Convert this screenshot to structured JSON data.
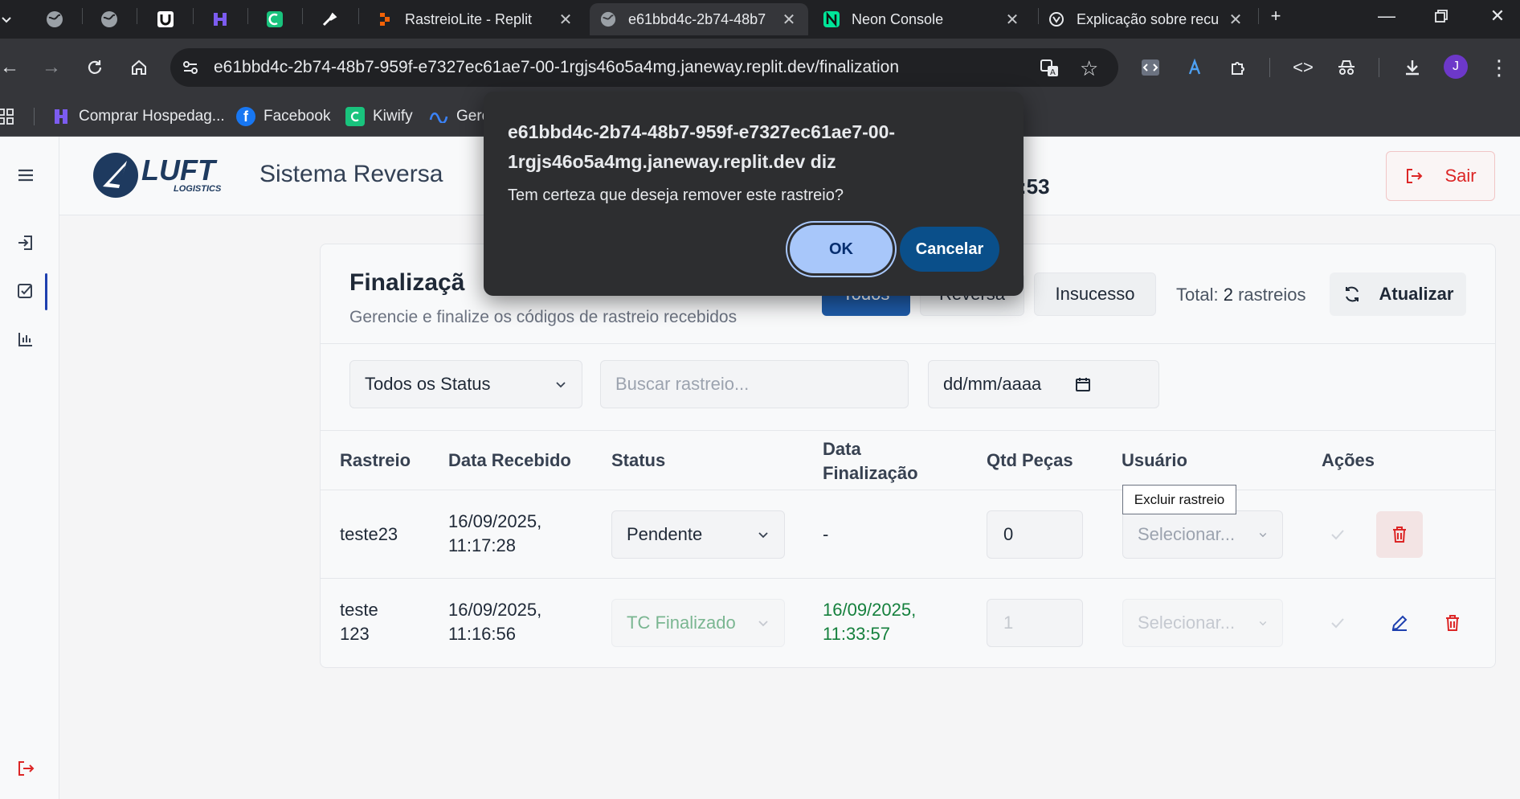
{
  "browser": {
    "tabs": [
      {
        "title": "RastreioLite - Replit"
      },
      {
        "title": "e61bbd4c-2b74-48b7"
      },
      {
        "title": "Neon Console"
      },
      {
        "title": "Explicação sobre recu"
      }
    ],
    "url": "e61bbd4c-2b74-48b7-959f-e7327ec61ae7-00-1rgjs46o5a4mg.janeway.replit.dev/finalization",
    "profile_initial": "J",
    "bookmarks": [
      {
        "label": "Comprar Hospedag..."
      },
      {
        "label": "Facebook"
      },
      {
        "label": "Kiwify"
      },
      {
        "label": "Gere"
      }
    ]
  },
  "app": {
    "brand": "LUFT",
    "brand_sub": "LOGISTICS",
    "title": "Sistema Reversa",
    "time_fragment": ":53",
    "logout_label": "Sair"
  },
  "card": {
    "title": "Finalizaçã",
    "subtitle": "Gerencie e finalize os códigos de rastreio recebidos",
    "filters": [
      {
        "label": "Todos"
      },
      {
        "label": "Reversa"
      },
      {
        "label": "Insucesso"
      }
    ],
    "total_label": "Total:",
    "total_value": "2",
    "total_suffix": "rastreios",
    "refresh_label": "Atualizar",
    "status_filter": "Todos os Status",
    "search_placeholder": "Buscar rastreio...",
    "date_placeholder": "dd/mm/aaaa"
  },
  "table": {
    "headers": [
      "Rastreio",
      "Data Recebido",
      "Status",
      "Data Finalização",
      "Qtd Peças",
      "Usuário",
      "Ações"
    ],
    "rows": [
      {
        "rastreio": "teste23",
        "data_recebido": "16/09/2025, 11:17:28",
        "status": "Pendente",
        "data_finalizacao": "-",
        "qtd": "0",
        "usuario": "Selecionar..."
      },
      {
        "rastreio": "teste 123",
        "data_recebido": "16/09/2025, 11:16:56",
        "status": "TC Finalizado",
        "data_finalizacao": "16/09/2025, 11:33:57",
        "qtd": "1",
        "usuario": "Selecionar..."
      }
    ]
  },
  "tooltip": "Excluir rastreio",
  "dialog": {
    "origin": "e61bbd4c-2b74-48b7-959f-e7327ec61ae7-00-1rgjs46o5a4mg.janeway.replit.dev diz",
    "message": "Tem certeza que deseja remover este rastreio?",
    "ok_label": "OK",
    "cancel_label": "Cancelar"
  },
  "colors": {
    "primary": "#1e5ba8",
    "danger": "#dc2626",
    "success_text": "#15803d",
    "dialog_bg": "#2d2e30"
  }
}
